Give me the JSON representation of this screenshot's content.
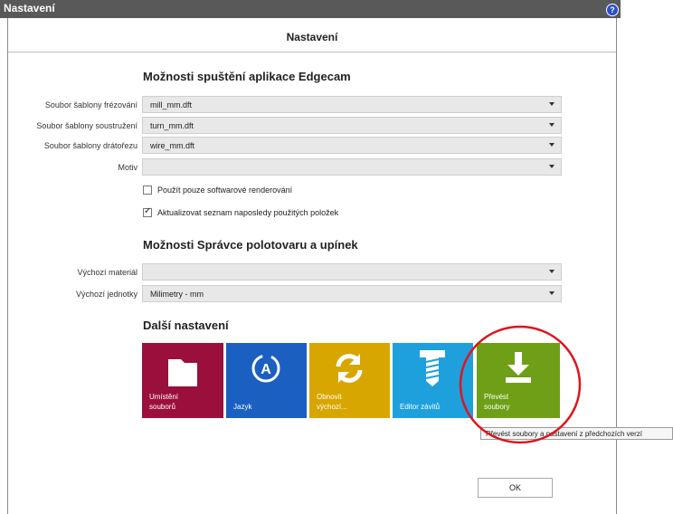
{
  "window": {
    "title": "Nastavení",
    "help_glyph": "?"
  },
  "header": {
    "title": "Nastavení"
  },
  "app_options": {
    "heading": "Možnosti spuštění aplikace Edgecam",
    "fields": [
      {
        "label": "Soubor šablony frézování",
        "value": "mill_mm.dft"
      },
      {
        "label": "Soubor šablony soustružení",
        "value": "turn_mm.dft"
      },
      {
        "label": "Soubor šablony drátořezu",
        "value": "wire_mm.dft"
      },
      {
        "label": "Motiv",
        "value": ""
      }
    ],
    "checkboxes": [
      {
        "label": "Použít pouze softwarové renderování",
        "checked": false
      },
      {
        "label": "Aktualizovat seznam naposledy použitých položek",
        "checked": true
      }
    ]
  },
  "stock_options": {
    "heading": "Možnosti Správce polotovaru a upínek",
    "fields": [
      {
        "label": "Výchozí materiál",
        "value": ""
      },
      {
        "label": "Výchozí jednotky",
        "value": "Milimetry - mm"
      }
    ]
  },
  "other": {
    "heading": "Další nastavení",
    "tiles": [
      {
        "line1": "Umístění",
        "line2": "souborů",
        "color": "#9b0f3c",
        "icon": "folder-icon"
      },
      {
        "line1": "Jazyk",
        "line2": "",
        "color": "#1b5fc1",
        "icon": "language-icon"
      },
      {
        "line1": "Obnovit",
        "line2": "výchozí...",
        "color": "#d7a600",
        "icon": "refresh-icon"
      },
      {
        "line1": "Editor závitů",
        "line2": "",
        "color": "#1ea0dd",
        "icon": "screw-icon"
      },
      {
        "line1": "Převést",
        "line2": "soubory",
        "color": "#6e9f16",
        "icon": "download-icon"
      }
    ]
  },
  "tooltip": {
    "text": "Převést soubory a nastavení z předchozích verzí"
  },
  "footer": {
    "ok_label": "OK"
  },
  "colors": {
    "titlebar": "#595959",
    "annotation": "#e0141c"
  }
}
